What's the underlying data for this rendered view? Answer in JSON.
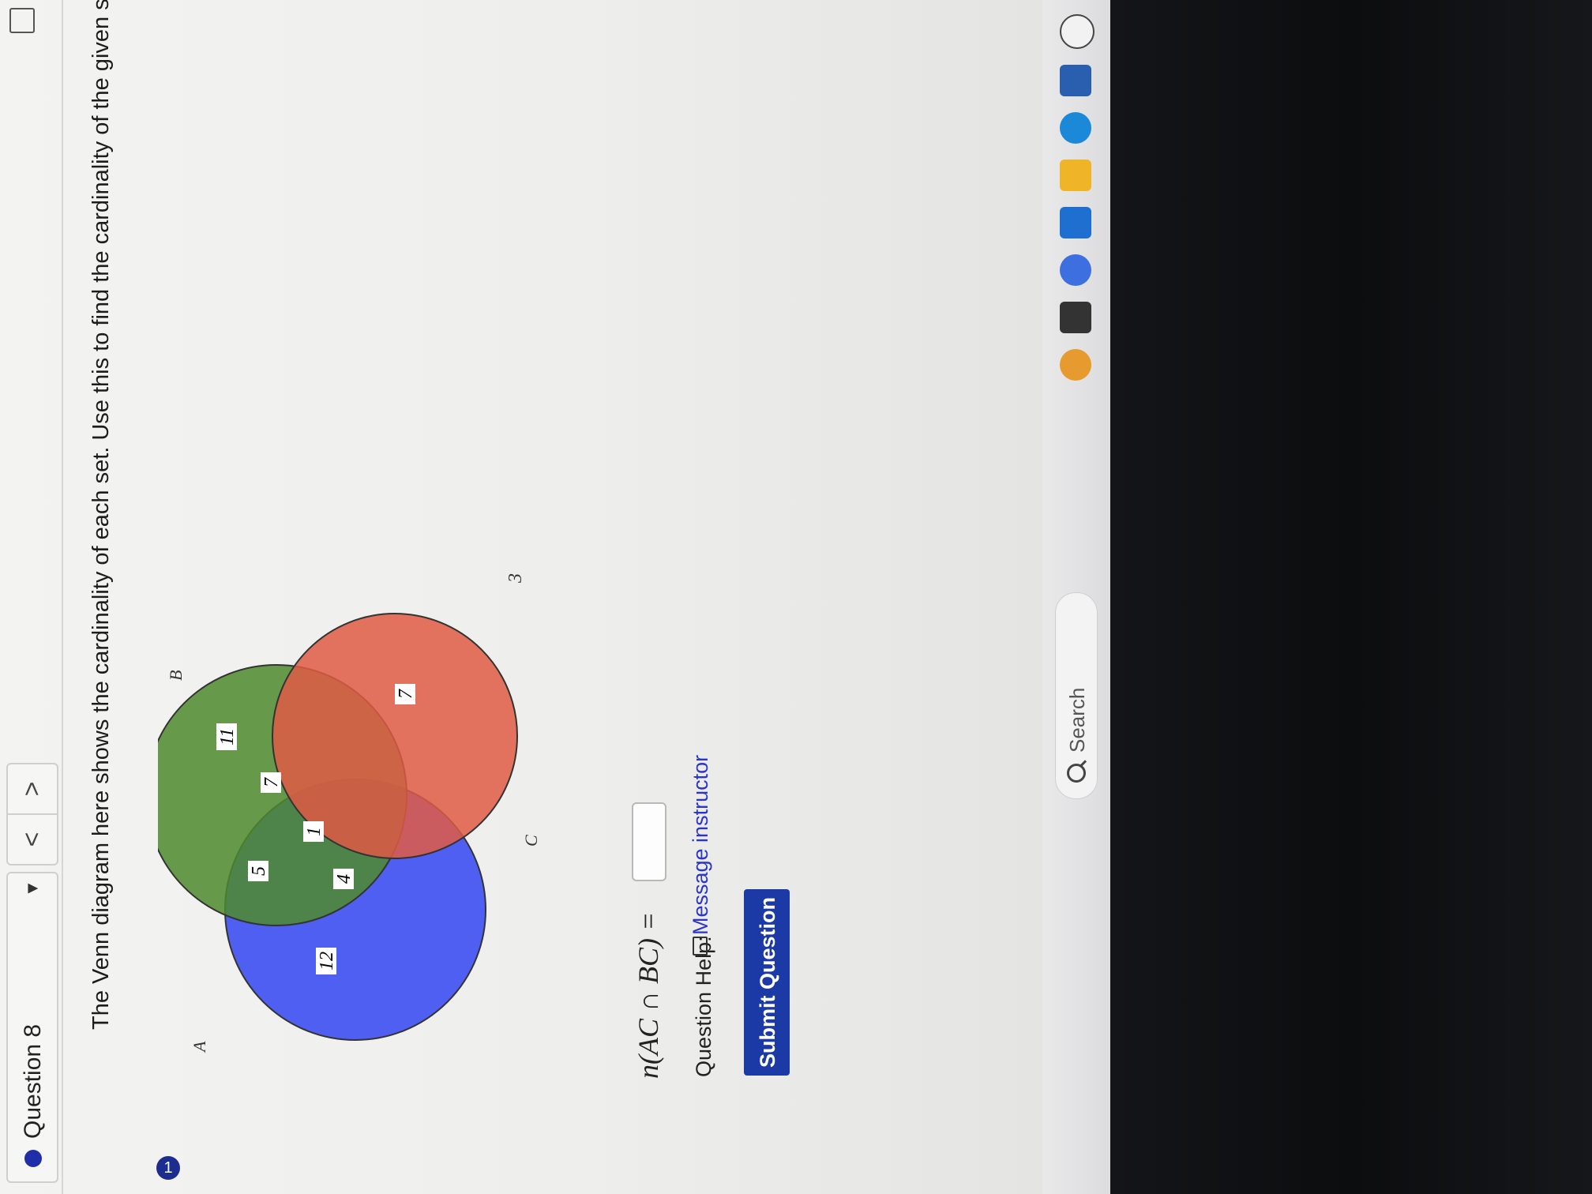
{
  "header": {
    "question_label": "Question 8",
    "dropdown_caret": "▼",
    "prev_label": "<",
    "next_label": ">"
  },
  "side": {
    "question_number": "1"
  },
  "prompt": "The Venn diagram here shows the cardinality of each set. Use this to find the cardinality of the given set.",
  "venn": {
    "set_labels": {
      "A": "A",
      "B": "B",
      "C": "C"
    },
    "regions": {
      "A_only": "12",
      "A_and_B_only": "5",
      "B_only": "11",
      "A_and_C_only": "4",
      "A_B_C": "1",
      "B_and_C_only": "7",
      "C_only": "7",
      "outside": "3"
    },
    "colors": {
      "A": "#3d4ff2",
      "B": "#4e8a2c",
      "C": "#df5a44"
    }
  },
  "equation": {
    "text": "n(AC ∩ BC) =",
    "input_value": ""
  },
  "help": {
    "label": "Question Help:",
    "message_link": "Message instructor"
  },
  "submit_label": "Submit Question",
  "taskbar": {
    "search_label": "Search"
  }
}
